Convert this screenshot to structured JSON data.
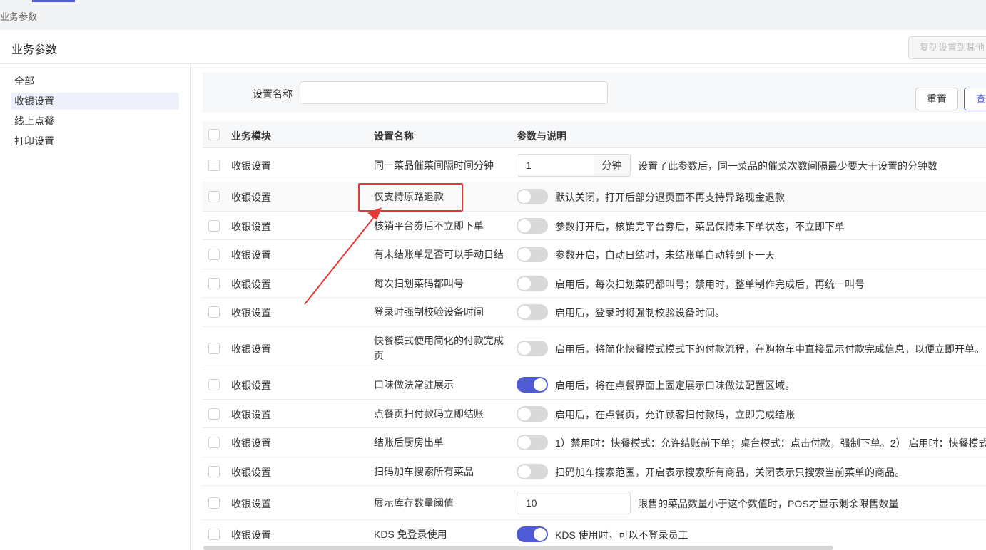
{
  "tab": {
    "label": "业务参数"
  },
  "header": {
    "title": "业务参数",
    "copy_button": "复制设置到其他"
  },
  "sidebar": {
    "items": [
      {
        "label": "全部",
        "active": false
      },
      {
        "label": "收银设置",
        "active": true
      },
      {
        "label": "线上点餐",
        "active": false
      },
      {
        "label": "打印设置",
        "active": false
      }
    ]
  },
  "filter": {
    "label": "设置名称",
    "value": "",
    "reset": "重置",
    "query": "查"
  },
  "table": {
    "headers": {
      "module": "业务模块",
      "name": "设置名称",
      "param": "参数与说明"
    },
    "rows": [
      {
        "module": "收银设置",
        "name": "同一菜品催菜间隔时间分钟",
        "type": "number",
        "value": "1",
        "unit": "分钟",
        "desc": "设置了此参数后，同一菜品的催菜次数间隔最少要大于设置的分钟数"
      },
      {
        "module": "收银设置",
        "name": "仅支持原路退款",
        "type": "toggle",
        "on": false,
        "desc": "默认关闭，打开后部分退页面不再支持异路现金退款"
      },
      {
        "module": "收银设置",
        "name": "核销平台劵后不立即下单",
        "type": "toggle",
        "on": false,
        "desc": "参数打开后，核销完平台劵后，菜品保持未下单状态，不立即下单"
      },
      {
        "module": "收银设置",
        "name": "有未结账单是否可以手动日结",
        "type": "toggle",
        "on": false,
        "desc": "参数开启，自动日结时，未结账单自动转到下一天"
      },
      {
        "module": "收银设置",
        "name": "每次扫划菜码都叫号",
        "type": "toggle",
        "on": false,
        "desc": "启用后，每次扫划菜码都叫号；禁用时，整单制作完成后，再统一叫号"
      },
      {
        "module": "收银设置",
        "name": "登录时强制校验设备时间",
        "type": "toggle",
        "on": false,
        "desc": "启用后，登录时将强制校验设备时间。"
      },
      {
        "module": "收银设置",
        "name": "快餐模式使用简化的付款完成页",
        "type": "toggle",
        "on": false,
        "desc": "启用后，将简化快餐模式模式下的付款流程，在购物车中直接显示付款完成信息，以便立即开单。"
      },
      {
        "module": "收银设置",
        "name": "口味做法常驻展示",
        "type": "toggle",
        "on": true,
        "desc": "启用后，将在点餐界面上固定展示口味做法配置区域。"
      },
      {
        "module": "收银设置",
        "name": "点餐页扫付款码立即结账",
        "type": "toggle",
        "on": false,
        "desc": "启用后，在点餐页，允许顾客扫付款码，立即完成结账"
      },
      {
        "module": "收银设置",
        "name": "结账后厨房出单",
        "type": "toggle",
        "on": false,
        "desc": "1）禁用时：快餐模式：允许结账前下单；桌台模式：点击付款，强制下单。2） 启用时：快餐模式"
      },
      {
        "module": "收银设置",
        "name": "扫码加车搜索所有菜品",
        "type": "toggle",
        "on": false,
        "desc": "扫码加车搜索范围，开启表示搜索所有商品，关闭表示只搜索当前菜单的商品。"
      },
      {
        "module": "收银设置",
        "name": "展示库存数量阈值",
        "type": "number",
        "value": "10",
        "unit": "",
        "desc": "限售的菜品数量小于这个数值时，POS才显示剩余限售数量"
      },
      {
        "module": "收银设置",
        "name": "KDS 免登录使用",
        "type": "toggle",
        "on": true,
        "desc": "KDS 使用时，可以不登录员工"
      }
    ]
  },
  "colors": {
    "accent": "#4f5bd5",
    "highlight": "#e53935"
  }
}
